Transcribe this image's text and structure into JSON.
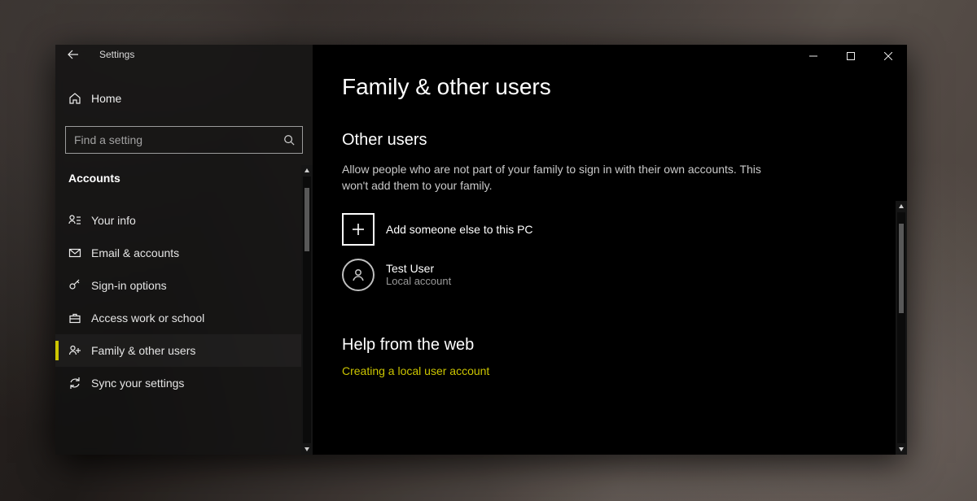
{
  "titlebar": {
    "app_name": "Settings"
  },
  "sidebar": {
    "home_label": "Home",
    "search_placeholder": "Find a setting",
    "section_label": "Accounts",
    "items": [
      {
        "icon": "person-lines",
        "label": "Your info"
      },
      {
        "icon": "mail",
        "label": "Email & accounts"
      },
      {
        "icon": "key",
        "label": "Sign-in options"
      },
      {
        "icon": "briefcase",
        "label": "Access work or school"
      },
      {
        "icon": "people-plus",
        "label": "Family & other users"
      },
      {
        "icon": "sync",
        "label": "Sync your settings"
      }
    ],
    "selected_index": 4
  },
  "page": {
    "title": "Family & other users",
    "other_users": {
      "heading": "Other users",
      "description": "Allow people who are not part of your family to sign in with their own accounts. This won't add them to your family.",
      "add_label": "Add someone else to this PC",
      "accounts": [
        {
          "name": "Test User",
          "type": "Local account"
        }
      ]
    },
    "help": {
      "heading": "Help from the web",
      "links": [
        "Creating a local user account"
      ]
    }
  }
}
